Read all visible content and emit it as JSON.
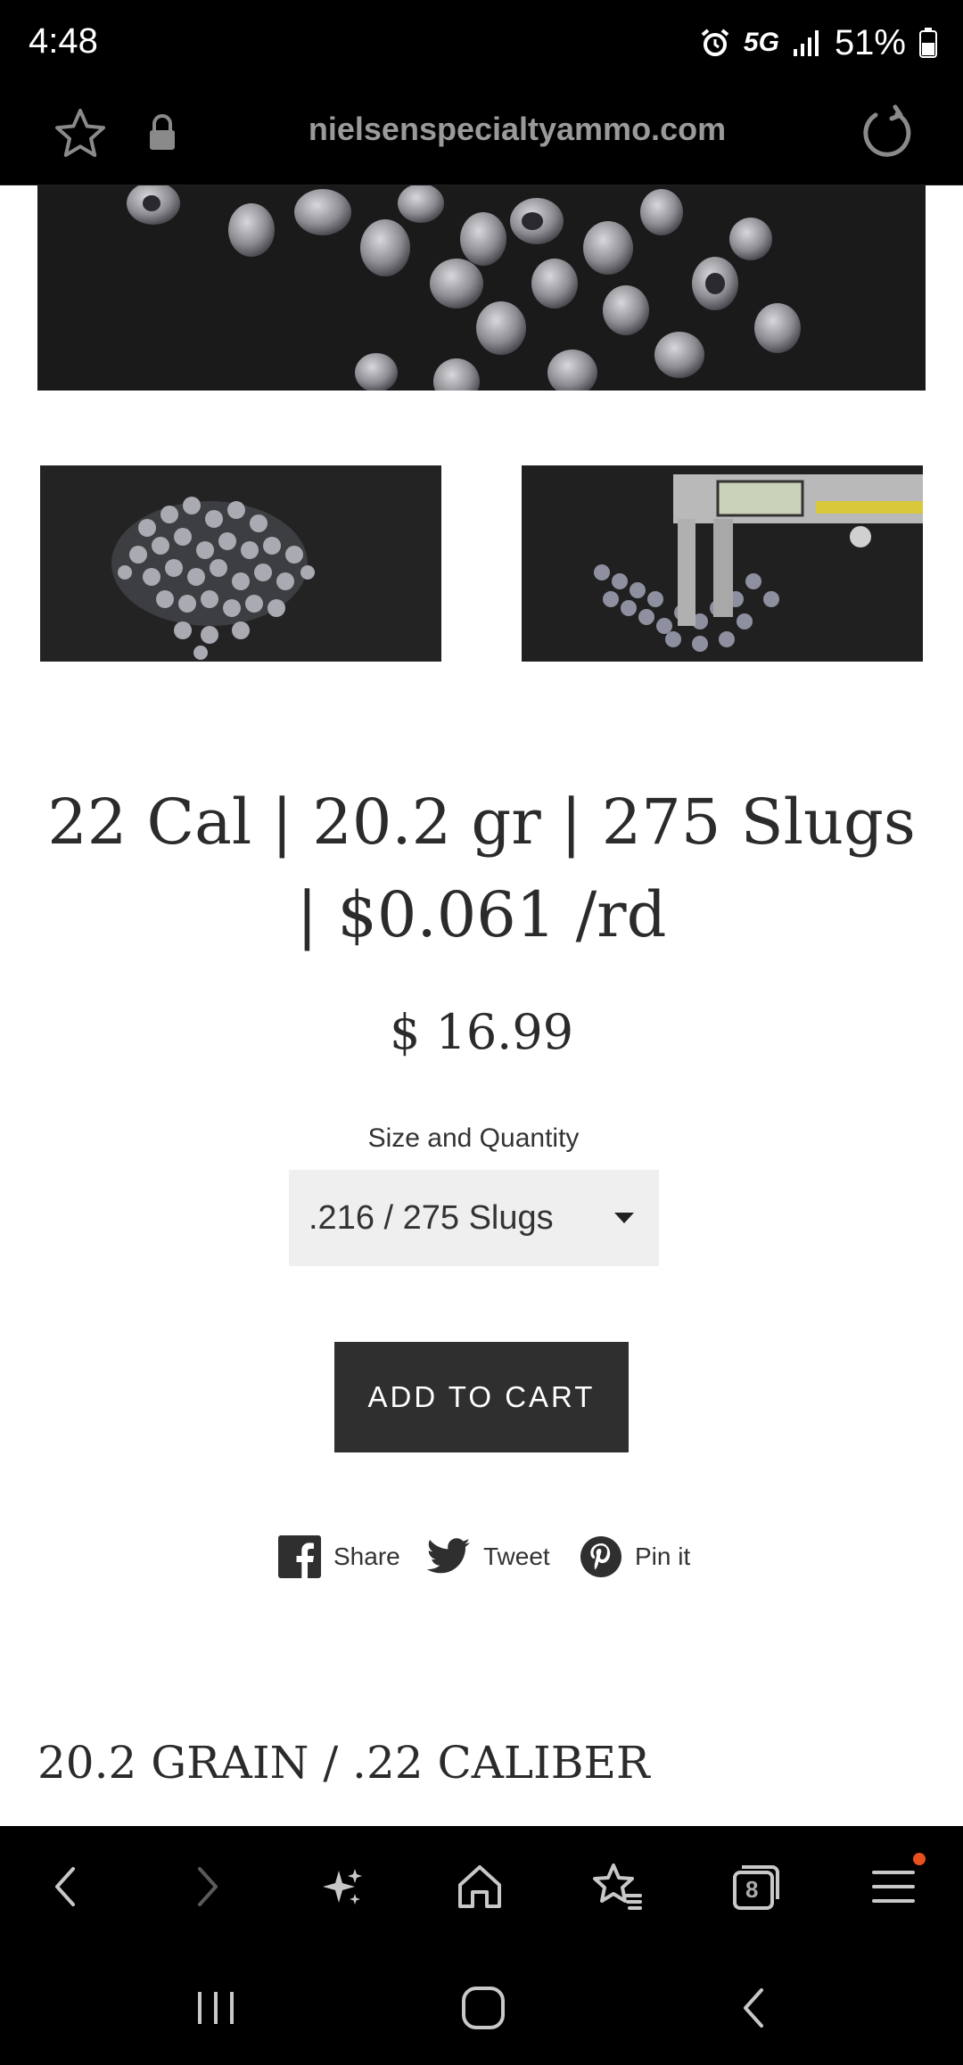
{
  "status_bar": {
    "time": "4:48",
    "network": "5G",
    "battery": "51%"
  },
  "url_bar": {
    "domain": "nielsenspecialtyammo.com"
  },
  "product": {
    "title_line1": "22 Cal | 20.2 gr | 275 Slugs",
    "title_line2": "| $0.061 /rd",
    "price": "$ 16.99",
    "variant_label": "Size and Quantity",
    "variant_value": ".216 / 275 Slugs",
    "add_to_cart": "ADD TO CART"
  },
  "social": {
    "share": "Share",
    "tweet": "Tweet",
    "pin": "Pin it"
  },
  "section_heading": "20.2 GRAIN / .22 CALIBER",
  "browser_toolbar": {
    "tab_count": "8"
  },
  "colors": {
    "button_bg": "#2f2f2f",
    "select_bg": "#efefef",
    "text": "#2b2b2b",
    "notification_dot": "#e8501c"
  }
}
